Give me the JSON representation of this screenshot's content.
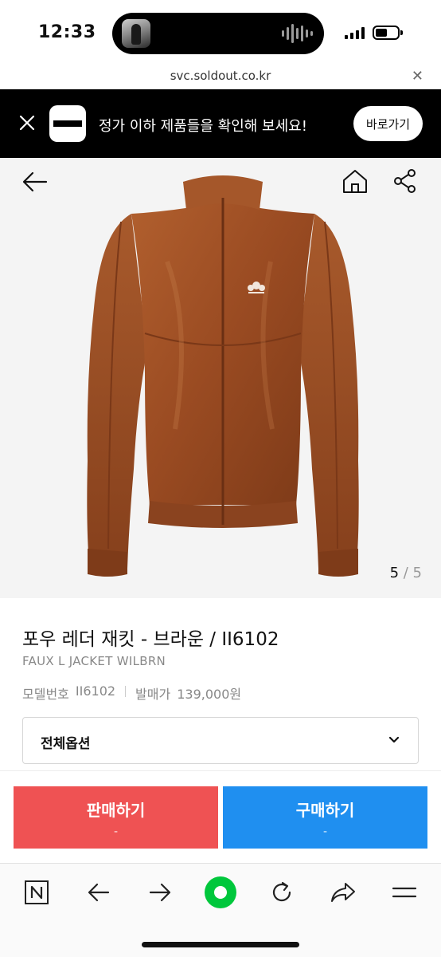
{
  "status_bar": {
    "time": "12:33"
  },
  "url_bar": {
    "url": "svc.soldout.co.kr",
    "close_glyph": "✕"
  },
  "app_banner": {
    "text": "정가 이하 제품들을 확인해 보세요!",
    "button_label": "바로가기"
  },
  "product_image": {
    "current_page": "5",
    "separator": " / ",
    "total_pages": "5"
  },
  "product": {
    "title": "포우 레더 재킷 - 브라운 / II6102",
    "subtitle": "FAUX L JACKET WILBRN",
    "model_label": "모델번호",
    "model_value": "II6102",
    "price_label": "발매가",
    "price_value": "139,000원"
  },
  "option_select": {
    "label": "전체옵션"
  },
  "actions": {
    "sell_label": "판매하기",
    "sell_price": "-",
    "buy_label": "구매하기",
    "buy_price": "-"
  },
  "toolbar": {
    "items": [
      "naver-icon",
      "back-arrow-icon",
      "forward-arrow-icon",
      "green-dot-icon",
      "refresh-icon",
      "share-arrow-icon",
      "menu-icon"
    ]
  },
  "colors": {
    "sell": "#ef5253",
    "buy": "#1f8ff0",
    "banner_bg": "#000000",
    "accent_green": "#00c73c",
    "jacket_brown": "#9c4f27"
  }
}
